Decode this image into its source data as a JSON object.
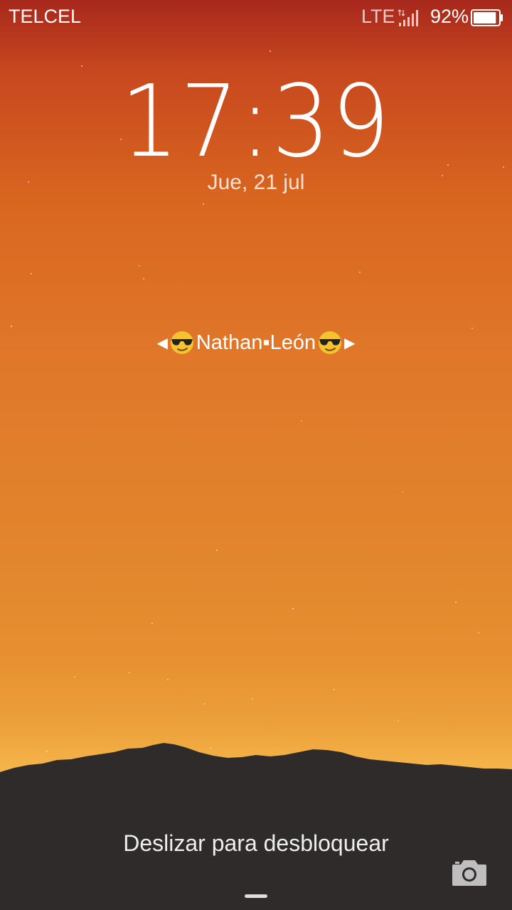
{
  "status_bar": {
    "carrier": "TELCEL",
    "network_type": "LTE",
    "battery_percent": "92%",
    "battery_level": 0.92,
    "signal_icon": "signal-bars-icon",
    "battery_icon": "battery-icon"
  },
  "lockscreen": {
    "time": "17:39",
    "date": "Jue, 21 jul",
    "owner_info": {
      "left_arrow": "◀",
      "name": "Nathan▪León",
      "right_arrow": "▶",
      "emoji_icon": "sunglasses-face-icon"
    },
    "unlock_hint": "Deslizar para desbloquear",
    "camera_icon": "camera-icon"
  },
  "colors": {
    "sky_top": "#a7281c",
    "sky_mid": "#e0782a",
    "sky_horizon": "#fbc457",
    "mountains": "#2e2b2a"
  }
}
